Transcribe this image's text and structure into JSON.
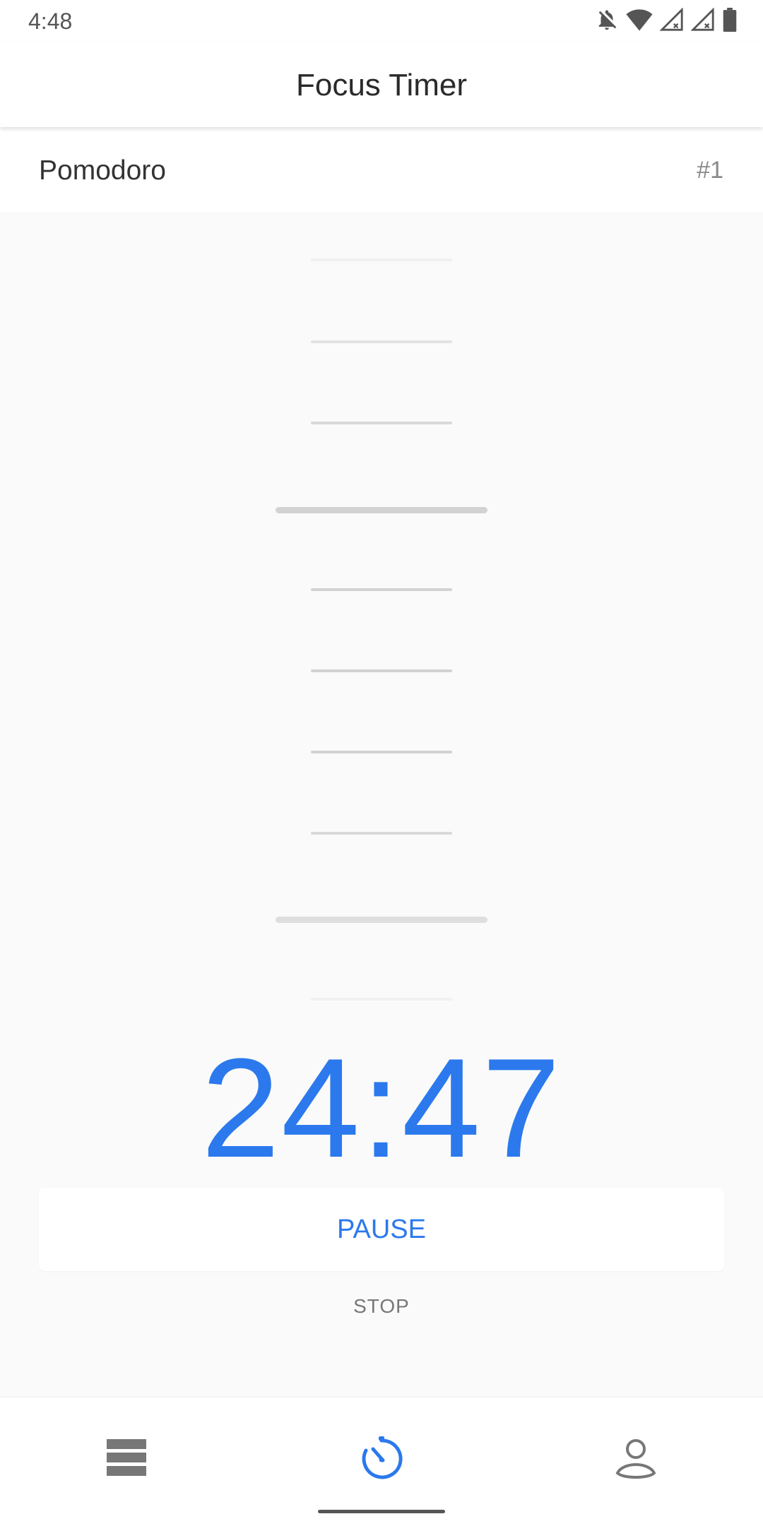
{
  "status_bar": {
    "time": "4:48",
    "icons": [
      "notifications-off-icon",
      "wifi-icon",
      "signal-icon",
      "signal-icon",
      "battery-icon"
    ]
  },
  "app_bar": {
    "title": "Focus Timer"
  },
  "task": {
    "name": "Pomodoro",
    "count": "#1"
  },
  "timer": {
    "display": "24:47"
  },
  "controls": {
    "pause_label": "PAUSE",
    "stop_label": "STOP"
  },
  "bottom_nav": {
    "items": [
      {
        "icon": "list-icon",
        "active": false
      },
      {
        "icon": "timer-icon",
        "active": true
      },
      {
        "icon": "profile-icon",
        "active": false
      }
    ]
  },
  "colors": {
    "accent": "#2b79ed",
    "inactive_icon": "#777777",
    "background": "#fafafa",
    "ruler_tick": "#d2d2d2"
  }
}
